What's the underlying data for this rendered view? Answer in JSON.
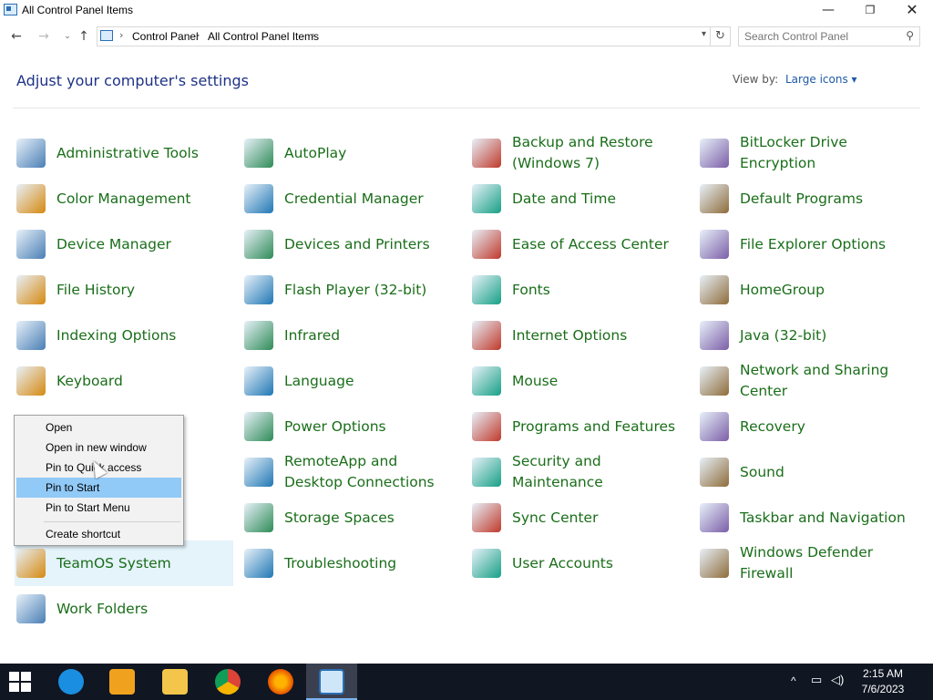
{
  "window": {
    "title": "All Control Panel Items",
    "minimize": "—",
    "maximize": "❐",
    "close": "✕"
  },
  "nav": {
    "back": "←",
    "forward": "→",
    "recent": "⌄",
    "up": "↑",
    "breadcrumbs": [
      "Control Panel",
      "All Control Panel Items"
    ],
    "refresh": "↻",
    "search_placeholder": "Search Control Panel"
  },
  "header": {
    "title": "Adjust your computer's settings",
    "view_by_label": "View by:",
    "view_by_value": "Large icons ▾"
  },
  "items": [
    [
      "Administrative Tools",
      "AutoPlay",
      "Backup and Restore (Windows 7)",
      "BitLocker Drive Encryption"
    ],
    [
      "Color Management",
      "Credential Manager",
      "Date and Time",
      "Default Programs"
    ],
    [
      "Device Manager",
      "Devices and Printers",
      "Ease of Access Center",
      "File Explorer Options"
    ],
    [
      "File History",
      "Flash Player (32-bit)",
      "Fonts",
      "HomeGroup"
    ],
    [
      "Indexing Options",
      "Infrared",
      "Internet Options",
      "Java (32-bit)"
    ],
    [
      "Keyboard",
      "Language",
      "Mouse",
      "Network and Sharing Center"
    ],
    [
      "",
      "Power Options",
      "Programs and Features",
      "Recovery"
    ],
    [
      "",
      "RemoteApp and Desktop Connections",
      "Security and Maintenance",
      "Sound"
    ],
    [
      "",
      "Storage Spaces",
      "Sync Center",
      "Taskbar and Navigation"
    ],
    [
      "TeamOS System",
      "Troubleshooting",
      "User Accounts",
      "Windows Defender Firewall"
    ],
    [
      "Work Folders",
      "",
      "",
      ""
    ]
  ],
  "context_menu": {
    "items": [
      "Open",
      "Open in new window",
      "Pin to Quick access",
      "Pin to Start",
      "Pin to Start Menu",
      "Create shortcut"
    ],
    "selected": "Pin to Start"
  },
  "taskbar": {
    "apps": [
      "windows-start",
      "internet-explorer",
      "media-player",
      "file-explorer",
      "chrome",
      "firefox",
      "control-panel"
    ],
    "tray": {
      "chevron": "^",
      "time": "2:15 AM",
      "date": "7/6/2023"
    }
  },
  "colors": {
    "item_text": "#1a6e1a",
    "heading": "#1e3287",
    "selection": "#91c9f7",
    "hover": "#e5f3fb",
    "taskbar": "#101622"
  }
}
